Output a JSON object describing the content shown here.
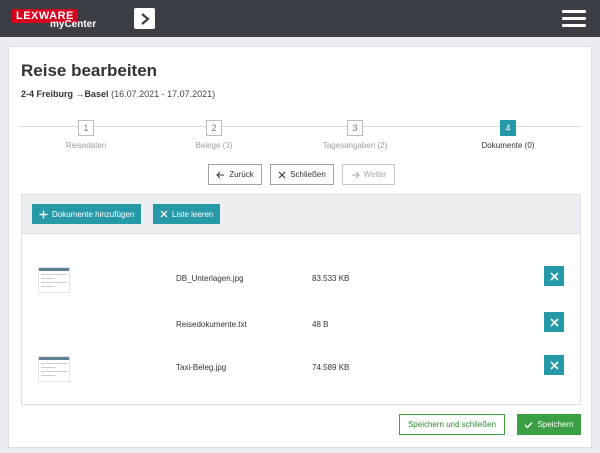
{
  "header": {
    "logo_brand": "LEXWARE",
    "logo_product": "myCenter",
    "expand_icon": "chevron-right-icon",
    "menu_icon": "hamburger-menu-icon"
  },
  "page": {
    "title": "Reise bearbeiten",
    "route": "2-4 Freiburg",
    "route_arrow": "→",
    "route_destination": "Basel",
    "dates": "(16.07.2021 - 17.07.2021)"
  },
  "steps": [
    {
      "num": "1",
      "label": "Reisedaten",
      "active": false
    },
    {
      "num": "2",
      "label": "Belege (3)",
      "active": false
    },
    {
      "num": "3",
      "label": "Tagesangaben (2)",
      "active": false
    },
    {
      "num": "4",
      "label": "Dokumente (0)",
      "active": true
    }
  ],
  "nav": {
    "back": "Zurück",
    "close": "Schließen",
    "next": "Weiter"
  },
  "toolbar": {
    "add_label": "Dokumente hinzufügen",
    "clear_label": "Liste leeren"
  },
  "files": [
    {
      "name": "DB_Unterlagen.jpg",
      "size": "83.533 KB",
      "has_thumb": true
    },
    {
      "name": "Reisedokumente.txt",
      "size": "48 B",
      "has_thumb": false
    },
    {
      "name": "Taxi-Beleg.jpg",
      "size": "74.589 KB",
      "has_thumb": true
    }
  ],
  "footer": {
    "save_close_label": "Speichern und schließen",
    "save_label": "Speichern"
  },
  "colors": {
    "accent": "#2699a8",
    "success": "#3aa043",
    "topbar": "#3b3f45",
    "brand_red": "#d6001c"
  }
}
